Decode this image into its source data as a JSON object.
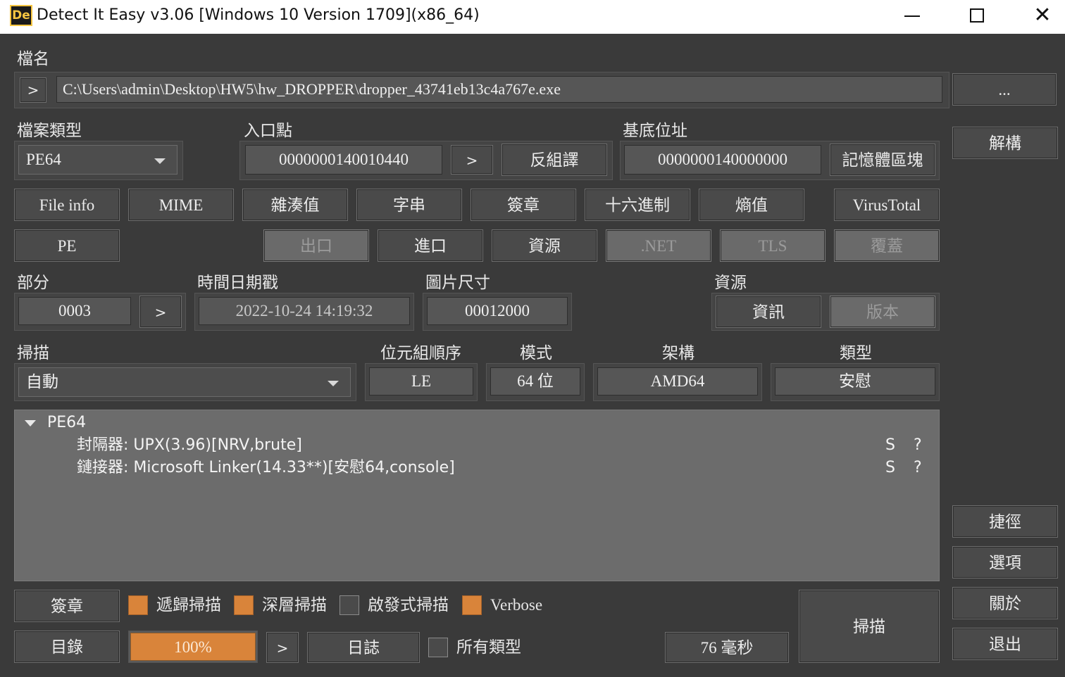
{
  "window": {
    "title": "Detect It Easy v3.06 [Windows 10 Version 1709](x86_64)",
    "icon_label": "De",
    "close_glyph": "✕"
  },
  "file": {
    "label": "檔名",
    "arrow_button": ">",
    "path": "C:\\Users\\admin\\Desktop\\HW5\\hw_DROPPER\\dropper_43741eb13c4a767e.exe",
    "browse_button": "..."
  },
  "file_type": {
    "label": "檔案類型",
    "value": "PE64"
  },
  "entry_point": {
    "label": "入口點",
    "value": "0000000140010440",
    "arrow_button": ">",
    "disasm_button": "反組譯"
  },
  "base_address": {
    "label": "基底位址",
    "value": "0000000140000000",
    "memory_map_button": "記憶體區塊"
  },
  "sidebar": {
    "disasm": "解構",
    "shortcuts": "捷徑",
    "options": "選項",
    "about": "關於",
    "exit": "退出"
  },
  "tool_buttons": {
    "file_info": "File info",
    "mime": "MIME",
    "hash": "雜湊值",
    "strings": "字串",
    "signatures": "簽章",
    "hex": "十六進制",
    "entropy": "熵值",
    "virustotal": "VirusTotal",
    "pe": "PE",
    "export": "出口",
    "import": "進口",
    "resources": "資源",
    "net": ".NET",
    "tls": "TLS",
    "overlay": "覆蓋"
  },
  "sections": {
    "label": "部分",
    "value": "0003",
    "arrow_button": ">"
  },
  "timestamp": {
    "label": "時間日期戳",
    "value": "2022-10-24 14:19:32"
  },
  "image_size": {
    "label": "圖片尺寸",
    "value": "00012000"
  },
  "resource_group": {
    "label": "資源",
    "info_button": "資訊",
    "version_button": "版本"
  },
  "scan": {
    "label": "掃描",
    "mode": "自動"
  },
  "byte_order": {
    "label": "位元組順序",
    "value": "LE"
  },
  "mode": {
    "label": "模式",
    "value": "64 位"
  },
  "arch": {
    "label": "架構",
    "value": "AMD64"
  },
  "type": {
    "label": "類型",
    "value": "安慰"
  },
  "results": {
    "root": "PE64",
    "rows": [
      {
        "text": "封隔器: UPX(3.96)[NRV,brute]",
        "s": "S",
        "q": "?"
      },
      {
        "text": "鏈接器: Microsoft Linker(14.33**)[安慰64,console]",
        "s": "S",
        "q": "?"
      }
    ]
  },
  "bottom": {
    "signatures_button": "簽章",
    "recursive_scan": {
      "label": "遞歸掃描",
      "checked": true
    },
    "deep_scan": {
      "label": "深層掃描",
      "checked": true
    },
    "heuristic_scan": {
      "label": "啟發式掃描",
      "checked": false
    },
    "verbose": {
      "label": "Verbose",
      "checked": true
    },
    "directory_button": "目錄",
    "progress": "100%",
    "progress_fraction": 1.0,
    "arrow_button": ">",
    "log_button": "日誌",
    "all_types": {
      "label": "所有類型",
      "checked": false
    },
    "elapsed": "76 毫秒",
    "scan_button": "掃描"
  },
  "colors": {
    "accent": "#d9843a",
    "background": "#3a3a3a",
    "results_bg": "#6c6c6c"
  }
}
